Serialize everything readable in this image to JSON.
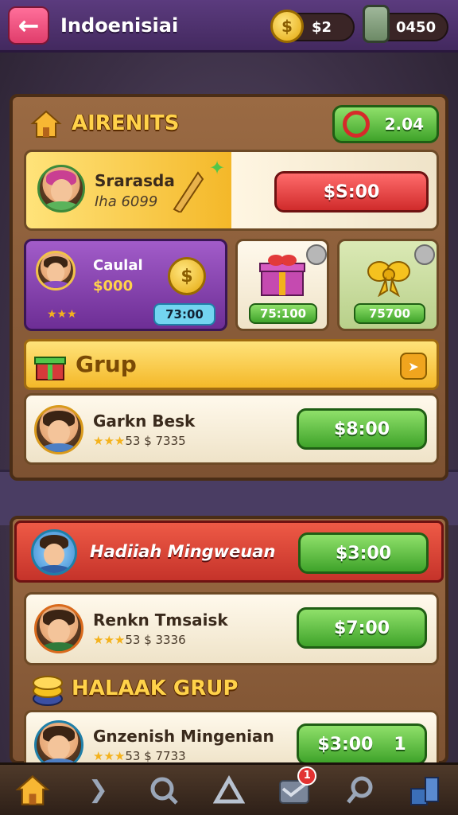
{
  "topbar": {
    "title": "Indoenisiai",
    "coins": "$2",
    "jars": "0450"
  },
  "panel1": {
    "title": "AIRENITS",
    "green_badge": "2.04",
    "featured": {
      "name": "Srarasda",
      "sub": "Iha 6099",
      "price": "$S:00"
    },
    "purple_card": {
      "name": "Caulal",
      "amount": "$000",
      "timer": "73:00"
    },
    "gift_card_1": {
      "label": "75:100"
    },
    "gift_card_2": {
      "label": "75700"
    },
    "section_title": "Grup",
    "row": {
      "name": "Garkn Besk",
      "stars": "★★★",
      "meta": "53 $ 7335",
      "price": "$8:00"
    }
  },
  "panel2": {
    "banner": {
      "name": "Hadiiah Mingweuan",
      "price": "$3:00"
    },
    "row1": {
      "name": "Renkn Tmsaisk",
      "stars": "★★★",
      "meta": "53 $ 3336",
      "price": "$7:00"
    },
    "section_title": "HALAAK GRUP",
    "row2": {
      "name": "Gnzenish Mingenian",
      "stars": "★★★",
      "meta": "53 $ 7733",
      "price": "$3:00",
      "extra": "1"
    }
  },
  "bottom_nav": {
    "badge": "1"
  },
  "colors": {
    "accent_green": "#3fa32a",
    "accent_red": "#d02b2b",
    "gold": "#ffd24a",
    "purple": "#6d2e95"
  }
}
